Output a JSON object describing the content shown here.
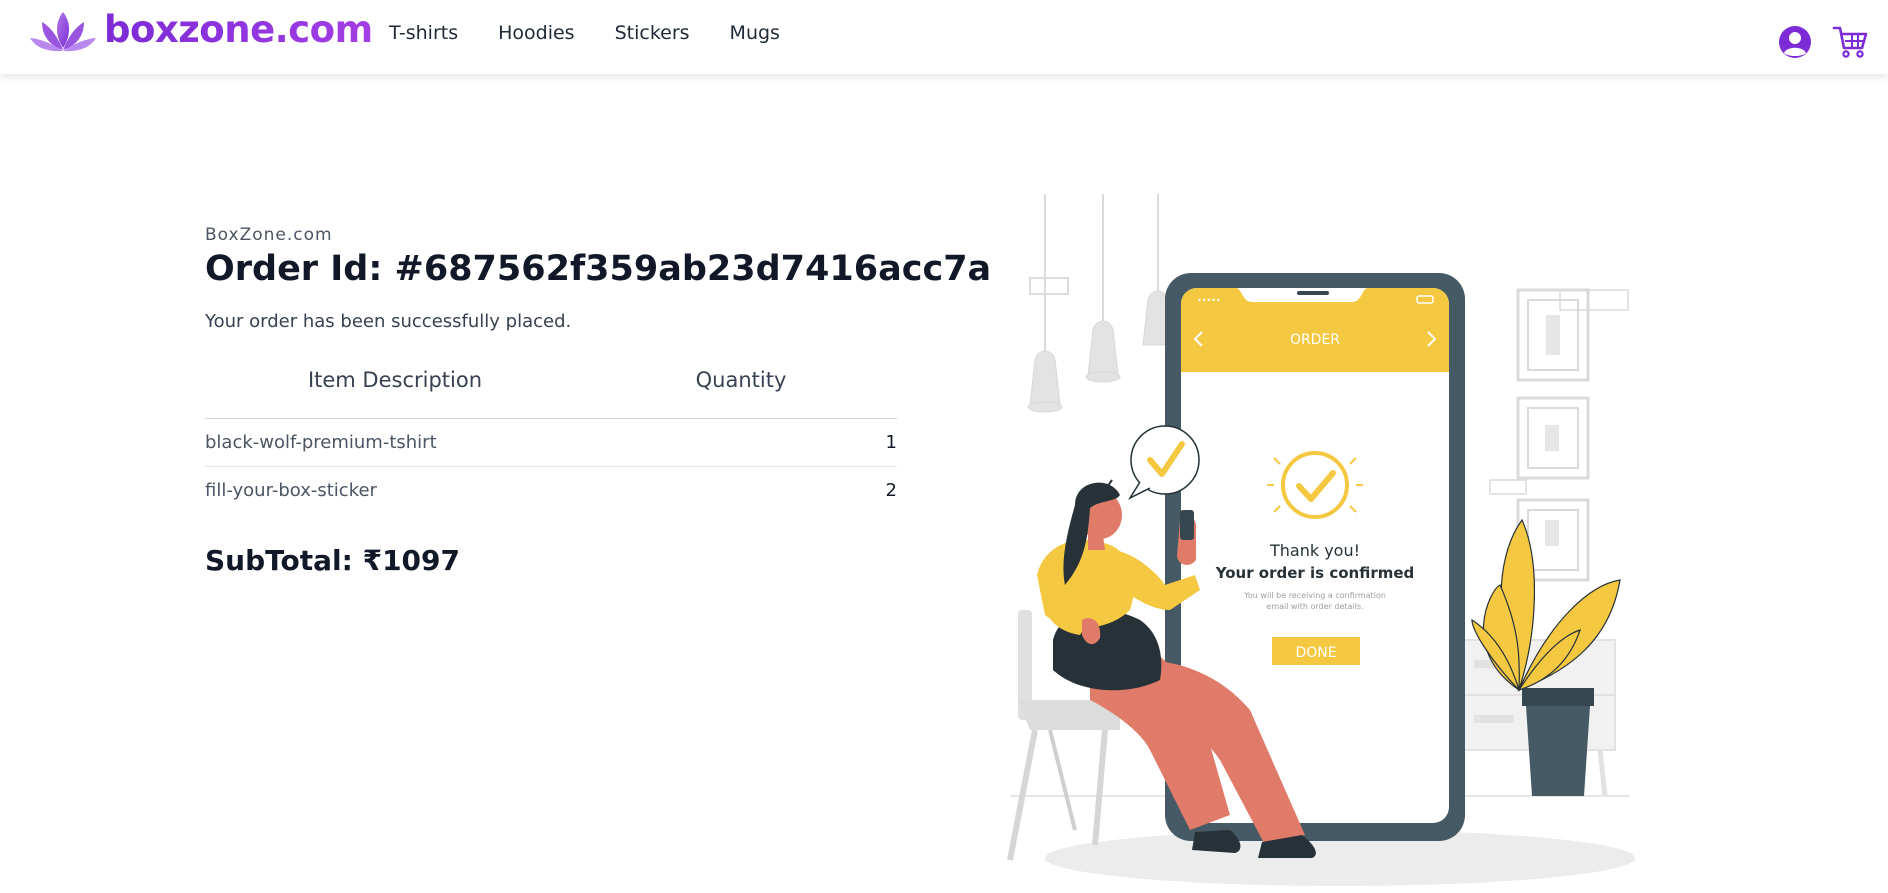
{
  "header": {
    "logo_text": "boxzone.com",
    "nav": [
      "T-shirts",
      "Hoodies",
      "Stickers",
      "Mugs"
    ],
    "user_icon": "user-circle-icon",
    "cart_icon": "cart-icon"
  },
  "order": {
    "brand": "BoxZone.com",
    "order_id": "Order Id: #687562f359ab23d7416acc7a",
    "message": "Your order has been successfully placed.",
    "columns": [
      "Item Description",
      "Quantity"
    ],
    "items": [
      {
        "name": "black-wolf-premium-tshirt",
        "quantity": "1"
      },
      {
        "name": "fill-your-box-sticker",
        "quantity": "2"
      }
    ],
    "subtotal": "SubTotal: ₹1097"
  },
  "illustration": {
    "screen_title": "ORDER",
    "thanks": "Thank you!",
    "confirmed": "Your order is confirmed",
    "small_text_1": "You will be receiving a confirmation",
    "small_text_2": "email with order details.",
    "done": "DONE"
  },
  "colors": {
    "brand_purple": "#7c2bd6",
    "accent_yellow": "#f5c842",
    "phone_dark": "#455a64",
    "skin": "#e07b6a"
  }
}
